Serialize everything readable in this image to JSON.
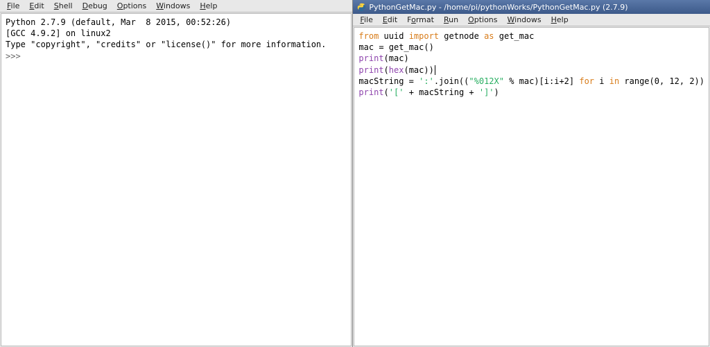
{
  "left": {
    "menu": {
      "file": "File",
      "edit": "Edit",
      "shell": "Shell",
      "debug": "Debug",
      "options": "Options",
      "windows": "Windows",
      "help": "Help"
    },
    "shell": {
      "line1": "Python 2.7.9 (default, Mar  8 2015, 00:52:26)",
      "line2": "[GCC 4.9.2] on linux2",
      "line3": "Type \"copyright\", \"credits\" or \"license()\" for more information.",
      "prompt": ">>> "
    }
  },
  "right": {
    "title": "PythonGetMac.py - /home/pi/pythonWorks/PythonGetMac.py (2.7.9)",
    "menu": {
      "file": "File",
      "edit": "Edit",
      "format": "Format",
      "run": "Run",
      "options": "Options",
      "windows": "Windows",
      "help": "Help"
    },
    "code": {
      "l1": {
        "from": "from",
        "uuid": " uuid ",
        "import": "import",
        "getnode": " getnode ",
        "as": "as",
        "getmac": " get_mac"
      },
      "l2": "mac = get_mac()",
      "l3": {
        "print": "print",
        "args": "(mac)"
      },
      "l4": {
        "print": "print",
        "hex": "hex",
        "open": "(",
        "args": "(mac))"
      },
      "l5": {
        "a": "macString = ",
        "s1": "':'",
        "b": ".join((",
        "s2": "\"%012X\"",
        "c": " % mac)[i:i+2] ",
        "for": "for",
        "d": " i ",
        "in": "in",
        "e": " range(0, 12, 2))"
      },
      "l6": {
        "print": "print",
        "open": "(",
        "s1": "'['",
        "a": " + macString + ",
        "s2": "']'",
        "close": ")"
      }
    }
  }
}
